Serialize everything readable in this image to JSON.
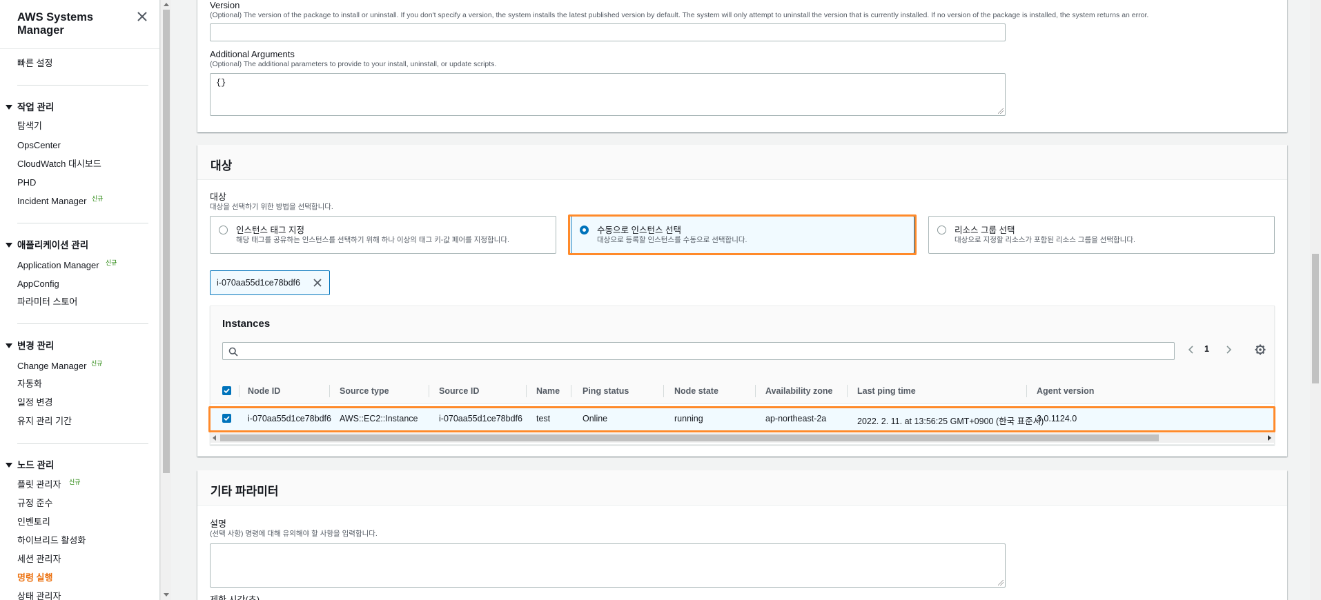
{
  "sidebar": {
    "title": "AWS Systems Manager",
    "quick_setup": "빠른 설정",
    "new_badge": "신규",
    "sections": [
      {
        "title": "작업 관리",
        "items": [
          "탐색기",
          "OpsCenter",
          "CloudWatch 대시보드",
          "PHD",
          "Incident Manager"
        ]
      },
      {
        "title": "애플리케이션 관리",
        "items": [
          "Application Manager",
          "AppConfig",
          "파라미터 스토어"
        ]
      },
      {
        "title": "변경 관리",
        "items": [
          "Change Manager",
          "자동화",
          "일정 변경",
          "유지 관리 기간"
        ]
      },
      {
        "title": "노드 관리",
        "items": [
          "플릿 관리자",
          "규정 준수",
          "인벤토리",
          "하이브리드 활성화",
          "세션 관리자",
          "명령 실행",
          "상태 관리자"
        ]
      }
    ]
  },
  "parameters": {
    "version_label": "Version",
    "version_desc": "(Optional) The version of the package to install or uninstall. If you don't specify a version, the system installs the latest published version by default. The system will only attempt to uninstall the version that is currently installed. If no version of the package is installed, the system returns an error.",
    "version_value": "",
    "args_label": "Additional Arguments",
    "args_desc": "(Optional) The additional parameters to provide to your install, uninstall, or update scripts.",
    "args_value": "{}"
  },
  "targets": {
    "section_title": "대상",
    "label": "대상",
    "desc": "대상을 선택하기 위한 방법을 선택합니다.",
    "options": [
      {
        "label": "인스턴스 태그 지정",
        "desc": "해당 태그를 공유하는 인스턴스를 선택하기 위해 하나 이상의 태그 키-값 페어를 지정합니다.",
        "selected": false
      },
      {
        "label": "수동으로 인스턴스 선택",
        "desc": "대상으로 등록할 인스턴스를 수동으로 선택합니다.",
        "selected": true
      },
      {
        "label": "리소스 그룹 선택",
        "desc": "대상으로 지정할 리소스가 포함된 리소스 그룹을 선택합니다.",
        "selected": false
      }
    ],
    "selected_token": "i-070aa55d1ce78bdf6",
    "instances": {
      "title": "Instances",
      "search_placeholder": "",
      "page": "1",
      "columns": [
        "Node ID",
        "Source type",
        "Source ID",
        "Name",
        "Ping status",
        "Node state",
        "Availability zone",
        "Last ping time",
        "Agent version"
      ],
      "rows": [
        [
          "i-070aa55d1ce78bdf6",
          "AWS::EC2::Instance",
          "i-070aa55d1ce78bdf6",
          "test",
          "Online",
          "running",
          "ap-northeast-2a",
          "2022. 2. 11. at 13:56:25 GMT+0900 (한국 표준시)",
          "3.0.1124.0"
        ]
      ]
    }
  },
  "other": {
    "section_title": "기타 파라미터",
    "comment_label": "설명",
    "comment_desc": "(선택 사항) 명령에 대해 유의해야 할 사항을 입력합니다.",
    "timeout_label": "제한 시간(초)"
  },
  "colors": {
    "accent": "#0073bb",
    "highlight": "#ff8a2a",
    "active_nav": "#ec7211",
    "new_badge": "#1d8102"
  }
}
